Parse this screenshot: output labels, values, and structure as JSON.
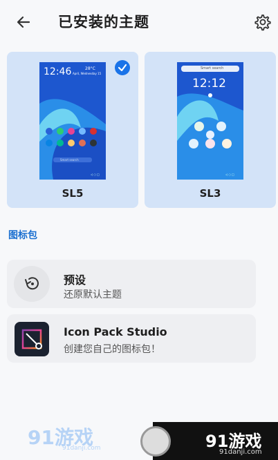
{
  "header": {
    "title": "已安装的主题",
    "back_icon": "arrow-left-icon",
    "settings_icon": "gear-icon"
  },
  "themes": [
    {
      "name": "SL5",
      "selected": true,
      "preview": {
        "time": "12:46",
        "weather_temp": "28°C",
        "date_line": "April, Wednesday 15",
        "search_hint": "Smart search"
      }
    },
    {
      "name": "SL3",
      "selected": false,
      "preview": {
        "time": "12:12",
        "search_hint": "Smart search"
      }
    }
  ],
  "section": {
    "label": "图标包"
  },
  "icon_packs": [
    {
      "title": "预设",
      "subtitle": "还原默认主题",
      "icon": "restore-icon"
    },
    {
      "title": "Icon Pack Studio",
      "subtitle": "创建您自己的图标包！",
      "icon": "icon-pack-studio-logo"
    }
  ],
  "watermark": {
    "left_logo": "91游戏",
    "left_url": "91danji.com",
    "right_logo": "91游戏",
    "right_url": "91danji.com"
  },
  "colors": {
    "accent": "#1a73e8",
    "card_bg": "#d3e3f8",
    "section_label": "#1a6fd0",
    "row_bg": "#eeeff2"
  }
}
